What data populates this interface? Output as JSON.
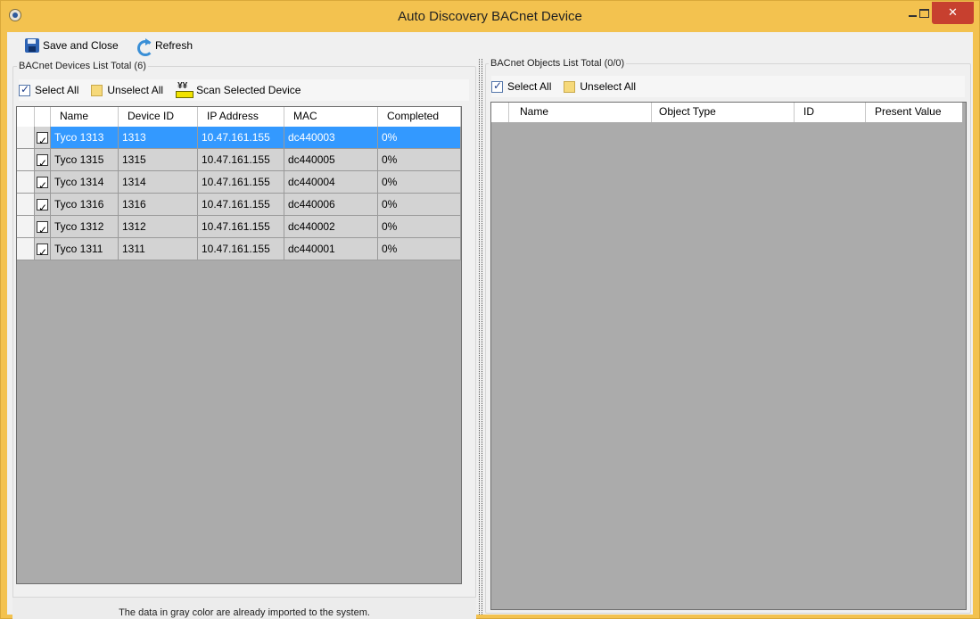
{
  "window": {
    "title": "Auto Discovery BACnet Device"
  },
  "toolbar": {
    "save_label": "Save and Close",
    "refresh_label": "Refresh"
  },
  "devices_panel": {
    "title": "BACnet Devices List Total (6)",
    "select_all": "Select All",
    "unselect_all": "Unselect All",
    "scan_selected": "Scan Selected Device",
    "columns": [
      "Name",
      "Device ID",
      "IP Address",
      "MAC",
      "Completed"
    ],
    "rows": [
      {
        "name": "Tyco 1313",
        "device_id": "1313",
        "ip": "10.47.161.155",
        "mac": "dc440003",
        "completed": "0%",
        "checked": true,
        "selected": true
      },
      {
        "name": "Tyco 1315",
        "device_id": "1315",
        "ip": "10.47.161.155",
        "mac": "dc440005",
        "completed": "0%",
        "checked": true,
        "selected": false
      },
      {
        "name": "Tyco 1314",
        "device_id": "1314",
        "ip": "10.47.161.155",
        "mac": "dc440004",
        "completed": "0%",
        "checked": true,
        "selected": false
      },
      {
        "name": "Tyco 1316",
        "device_id": "1316",
        "ip": "10.47.161.155",
        "mac": "dc440006",
        "completed": "0%",
        "checked": true,
        "selected": false
      },
      {
        "name": "Tyco 1312",
        "device_id": "1312",
        "ip": "10.47.161.155",
        "mac": "dc440002",
        "completed": "0%",
        "checked": true,
        "selected": false
      },
      {
        "name": "Tyco 1311",
        "device_id": "1311",
        "ip": "10.47.161.155",
        "mac": "dc440001",
        "completed": "0%",
        "checked": true,
        "selected": false
      }
    ],
    "footer_note": "The data in gray color are already imported to the system."
  },
  "objects_panel": {
    "title": "BACnet Objects List Total (0/0)",
    "select_all": "Select All",
    "unselect_all": "Unselect All",
    "columns": [
      "Name",
      "Object Type",
      "ID",
      "Present Value"
    ]
  },
  "colors": {
    "title_bar": "#f3c24f",
    "close_button": "#c7402f",
    "selected_row": "#3399ff",
    "imported_row": "#d3d3d3",
    "grid_background": "#ababab"
  }
}
